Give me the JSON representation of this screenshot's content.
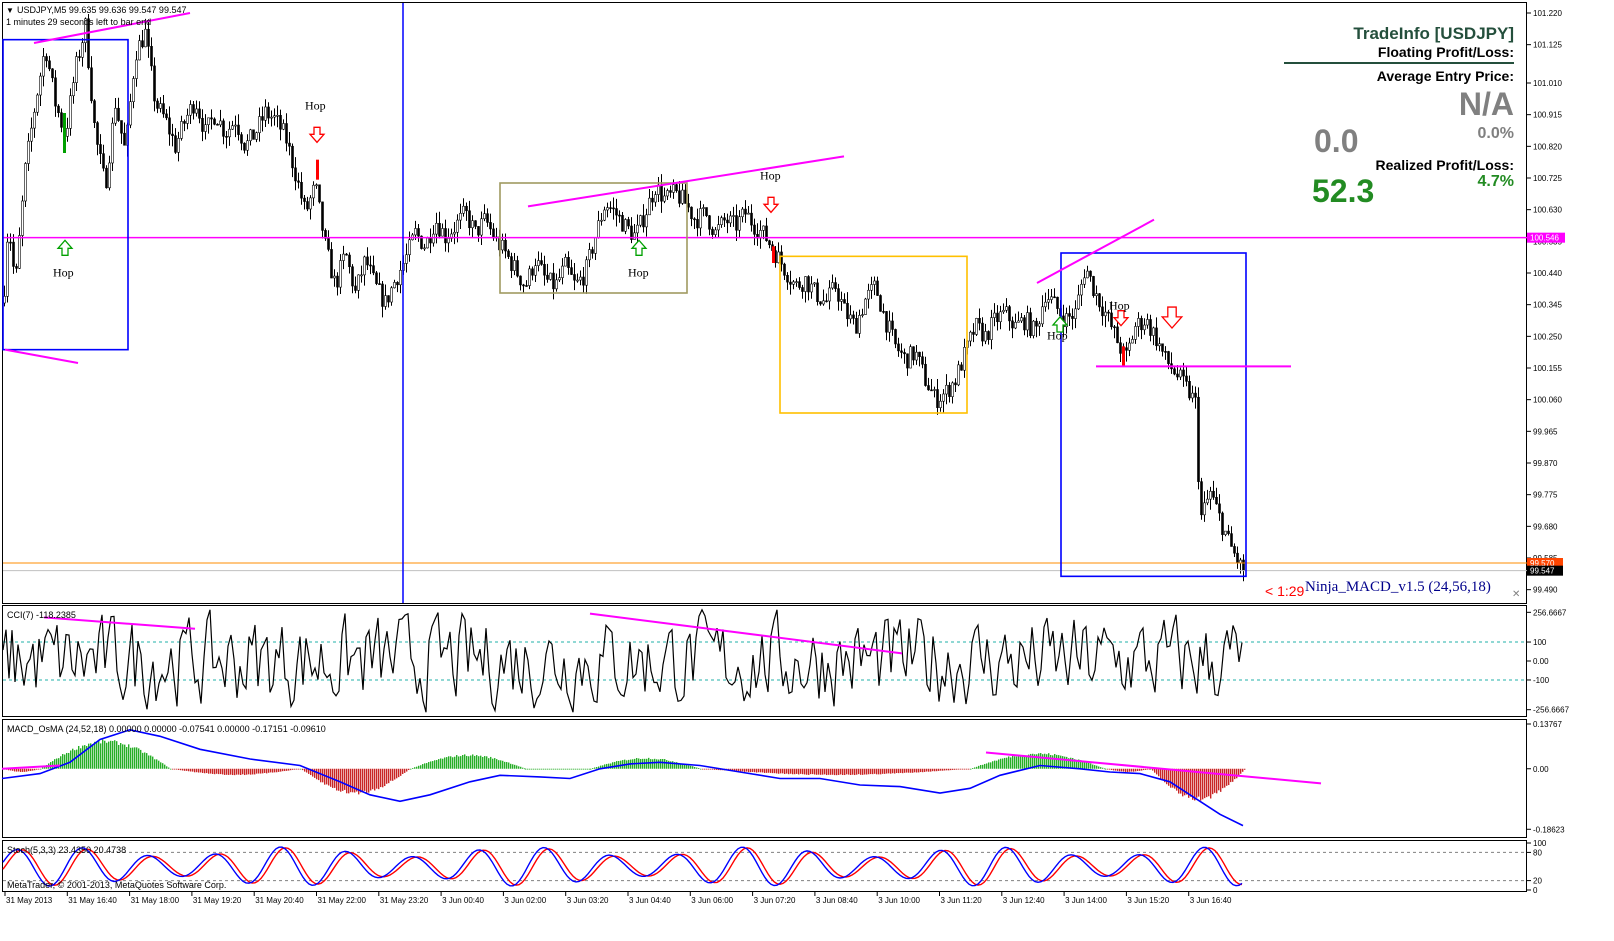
{
  "header": {
    "symbol_line": "USDJPY,M5  99.635 99.636 99.547 99.547",
    "countdown": "1 minutes 29 seconds left to bar end",
    "copyright": "MetaTrader, © 2001-2013, MetaQuotes Software Corp."
  },
  "tradeinfo": {
    "title": "TradeInfo [USDJPY]",
    "floating_label": "Floating Profit/Loss:",
    "avg_entry_label": "Average Entry Price:",
    "avg_entry_value": "N/A",
    "floating_value": "0.0",
    "floating_pct": "0.0%",
    "realized_label": "Realized Profit/Loss:",
    "realized_value": "52.3",
    "realized_pct": "4.7%"
  },
  "colors": {
    "magenta": "#ff00ff",
    "blue": "#0000ff",
    "olive": "#a09a60",
    "gold": "#ffc000",
    "red_arrow": "#ff0000",
    "green_arrow": "#00a000",
    "osma_green": "#00a000",
    "osma_red": "#c00000",
    "stoch_red": "#ff0000",
    "stoch_blue": "#0000ff",
    "text_green": "#228b22"
  },
  "chart_data": {
    "type": "candlestick",
    "symbol": "USDJPY",
    "timeframe": "M5",
    "bid": 99.547,
    "ask_label": "99.570",
    "bid_label": "99.547",
    "magenta_level_label": "100.546",
    "magenta_level": 100.546,
    "orange_level": 99.57,
    "ylim": [
      99.45,
      101.25
    ],
    "y_ticks": [
      "101.220",
      "101.125",
      "101.010",
      "100.915",
      "100.820",
      "100.725",
      "100.630",
      "100.535",
      "100.440",
      "100.345",
      "100.250",
      "100.155",
      "100.060",
      "99.965",
      "99.870",
      "99.775",
      "99.680",
      "99.585",
      "99.490"
    ],
    "x_ticks": [
      "31 May 2013",
      "31 May 16:40",
      "31 May 18:00",
      "31 May 19:20",
      "31 May 20:40",
      "31 May 22:00",
      "31 May 23:20",
      "3 Jun 00:40",
      "3 Jun 02:00",
      "3 Jun 03:20",
      "3 Jun 04:40",
      "3 Jun 06:00",
      "3 Jun 07:20",
      "3 Jun 08:40",
      "3 Jun 10:00",
      "3 Jun 11:20",
      "3 Jun 12:40",
      "3 Jun 14:00",
      "3 Jun 15:20",
      "3 Jun 16:40"
    ],
    "price_path": [
      [
        0,
        100.2
      ],
      [
        8,
        100.6
      ],
      [
        15,
        100.4
      ],
      [
        25,
        100.75
      ],
      [
        35,
        100.95
      ],
      [
        45,
        101.12
      ],
      [
        55,
        100.95
      ],
      [
        65,
        100.85
      ],
      [
        75,
        101.05
      ],
      [
        85,
        101.18
      ],
      [
        95,
        100.85
      ],
      [
        105,
        100.7
      ],
      [
        115,
        100.95
      ],
      [
        125,
        100.8
      ],
      [
        135,
        101.1
      ],
      [
        145,
        101.16
      ],
      [
        155,
        100.95
      ],
      [
        165,
        100.9
      ],
      [
        175,
        100.82
      ],
      [
        185,
        100.9
      ],
      [
        195,
        100.96
      ],
      [
        205,
        100.86
      ],
      [
        215,
        100.92
      ],
      [
        225,
        100.86
      ],
      [
        235,
        100.9
      ],
      [
        245,
        100.82
      ],
      [
        255,
        100.86
      ],
      [
        265,
        100.92
      ],
      [
        275,
        100.9
      ],
      [
        285,
        100.85
      ],
      [
        295,
        100.74
      ],
      [
        305,
        100.62
      ],
      [
        315,
        100.7
      ],
      [
        325,
        100.52
      ],
      [
        335,
        100.4
      ],
      [
        345,
        100.5
      ],
      [
        355,
        100.38
      ],
      [
        365,
        100.48
      ],
      [
        375,
        100.4
      ],
      [
        385,
        100.35
      ],
      [
        395,
        100.42
      ],
      [
        405,
        100.48
      ],
      [
        415,
        100.56
      ],
      [
        425,
        100.52
      ],
      [
        435,
        100.6
      ],
      [
        445,
        100.55
      ],
      [
        455,
        100.58
      ],
      [
        465,
        100.62
      ],
      [
        475,
        100.56
      ],
      [
        485,
        100.6
      ],
      [
        495,
        100.54
      ],
      [
        505,
        100.5
      ],
      [
        515,
        100.45
      ],
      [
        525,
        100.4
      ],
      [
        535,
        100.48
      ],
      [
        545,
        100.42
      ],
      [
        555,
        100.4
      ],
      [
        565,
        100.46
      ],
      [
        575,
        100.4
      ],
      [
        585,
        100.44
      ],
      [
        595,
        100.55
      ],
      [
        605,
        100.65
      ],
      [
        615,
        100.62
      ],
      [
        625,
        100.58
      ],
      [
        635,
        100.55
      ],
      [
        645,
        100.62
      ],
      [
        655,
        100.7
      ],
      [
        665,
        100.66
      ],
      [
        675,
        100.68
      ],
      [
        685,
        100.65
      ],
      [
        695,
        100.6
      ],
      [
        705,
        100.62
      ],
      [
        715,
        100.56
      ],
      [
        725,
        100.6
      ],
      [
        735,
        100.58
      ],
      [
        745,
        100.62
      ],
      [
        755,
        100.58
      ],
      [
        765,
        100.55
      ],
      [
        775,
        100.5
      ],
      [
        785,
        100.45
      ],
      [
        795,
        100.4
      ],
      [
        805,
        100.42
      ],
      [
        815,
        100.38
      ],
      [
        825,
        100.35
      ],
      [
        835,
        100.4
      ],
      [
        845,
        100.32
      ],
      [
        855,
        100.28
      ],
      [
        865,
        100.36
      ],
      [
        875,
        100.4
      ],
      [
        885,
        100.3
      ],
      [
        895,
        100.22
      ],
      [
        905,
        100.18
      ],
      [
        915,
        100.2
      ],
      [
        925,
        100.12
      ],
      [
        935,
        100.06
      ],
      [
        945,
        100.08
      ],
      [
        955,
        100.12
      ],
      [
        965,
        100.2
      ],
      [
        975,
        100.28
      ],
      [
        985,
        100.25
      ],
      [
        995,
        100.3
      ],
      [
        1005,
        100.32
      ],
      [
        1015,
        100.28
      ],
      [
        1025,
        100.3
      ],
      [
        1035,
        100.26
      ],
      [
        1045,
        100.38
      ],
      [
        1055,
        100.34
      ],
      [
        1065,
        100.3
      ],
      [
        1075,
        100.32
      ],
      [
        1085,
        100.46
      ],
      [
        1095,
        100.38
      ],
      [
        1105,
        100.32
      ],
      [
        1115,
        100.25
      ],
      [
        1125,
        100.18
      ],
      [
        1135,
        100.28
      ],
      [
        1145,
        100.3
      ],
      [
        1155,
        100.25
      ],
      [
        1165,
        100.18
      ],
      [
        1175,
        100.14
      ],
      [
        1185,
        100.1
      ],
      [
        1195,
        100.05
      ],
      [
        1200,
        99.7
      ],
      [
        1210,
        99.78
      ],
      [
        1220,
        99.7
      ],
      [
        1230,
        99.62
      ],
      [
        1240,
        99.56
      ],
      [
        1244,
        99.547
      ]
    ],
    "trendlines": [
      {
        "x1": 34,
        "y1": 101.13,
        "x2": 190,
        "y2": 101.22
      },
      {
        "x1": 5,
        "y1": 100.21,
        "x2": 78,
        "y2": 100.17
      },
      {
        "x1": 528,
        "y1": 100.64,
        "x2": 844,
        "y2": 100.79
      },
      {
        "x1": 1037,
        "y1": 100.41,
        "x2": 1154,
        "y2": 100.6
      },
      {
        "x1": 1096,
        "y1": 100.16,
        "x2": 1291,
        "y2": 100.16
      }
    ],
    "boxes": [
      {
        "x1": 3,
        "y1": 101.14,
        "x2": 128,
        "y2": 100.21,
        "color": "blue"
      },
      {
        "x1": 500,
        "y1": 100.71,
        "x2": 687,
        "y2": 100.38,
        "color": "olive"
      },
      {
        "x1": 780,
        "y1": 100.49,
        "x2": 967,
        "y2": 100.02,
        "color": "gold"
      },
      {
        "x1": 1061,
        "y1": 100.5,
        "x2": 1246,
        "y2": 99.53,
        "color": "blue"
      }
    ],
    "vline_x": 403,
    "annotations": [
      {
        "text": "Hop",
        "x": 305,
        "y": 100.93
      },
      {
        "text": "Hop",
        "x": 53,
        "y": 100.43
      },
      {
        "text": "Hop",
        "x": 628,
        "y": 100.43
      },
      {
        "text": "Hop",
        "x": 760,
        "y": 100.72
      },
      {
        "text": "Hop",
        "x": 1109,
        "y": 100.33
      },
      {
        "text": "Hop",
        "x": 1047,
        "y": 100.24
      }
    ],
    "arrows": [
      {
        "dir": "down",
        "x": 317,
        "y": 100.85,
        "size": 1
      },
      {
        "dir": "up",
        "x": 65,
        "y": 100.52,
        "size": 1
      },
      {
        "dir": "up",
        "x": 639,
        "y": 100.52,
        "size": 1
      },
      {
        "dir": "down",
        "x": 771,
        "y": 100.64,
        "size": 1
      },
      {
        "dir": "down",
        "x": 1121,
        "y": 100.3,
        "size": 1
      },
      {
        "dir": "down",
        "x": 1172,
        "y": 100.3,
        "size": 1.4
      },
      {
        "dir": "up",
        "x": 1060,
        "y": 100.29,
        "size": 1
      }
    ],
    "indicator_label": "Ninja_MACD_v1.5 (24,56,18)",
    "bar_timer": "< 1:29",
    "cci": {
      "label": "CCI(7) -118.2385",
      "ylim": [
        -290,
        290
      ],
      "ticks": [
        "256.6667",
        "100",
        "0.00",
        "-100",
        "-256.6667"
      ],
      "levels": [
        100,
        -100
      ],
      "divergence_lines": [
        {
          "x1": 44,
          "y1": 230,
          "x2": 195,
          "y2": 170
        },
        {
          "x1": 590,
          "y1": 250,
          "x2": 902,
          "y2": 40
        }
      ]
    },
    "macd": {
      "label": "MACD_OsMA (24,52,18) 0.00000 0.00000 -0.07541 0.00000 -0.17151 -0.09610",
      "ylim": [
        -0.21,
        0.15
      ],
      "ticks": [
        "0.13767",
        "0.00",
        "-0.18623"
      ],
      "osma_segments": [
        {
          "x1": 2,
          "x2": 40,
          "peak": -0.01
        },
        {
          "x1": 40,
          "x2": 170,
          "peak": 0.09
        },
        {
          "x1": 170,
          "x2": 300,
          "peak": -0.02
        },
        {
          "x1": 300,
          "x2": 410,
          "peak": -0.08
        },
        {
          "x1": 410,
          "x2": 525,
          "peak": 0.045
        },
        {
          "x1": 525,
          "x2": 590,
          "peak": 0.0
        },
        {
          "x1": 590,
          "x2": 700,
          "peak": 0.035
        },
        {
          "x1": 700,
          "x2": 970,
          "peak": -0.02
        },
        {
          "x1": 970,
          "x2": 1105,
          "peak": 0.05
        },
        {
          "x1": 1105,
          "x2": 1150,
          "peak": -0.01
        },
        {
          "x1": 1150,
          "x2": 1245,
          "peak": -0.1
        }
      ],
      "macd_line": [
        [
          2,
          -0.03
        ],
        [
          40,
          -0.015
        ],
        [
          70,
          0.02
        ],
        [
          100,
          0.09
        ],
        [
          130,
          0.12
        ],
        [
          160,
          0.1
        ],
        [
          200,
          0.06
        ],
        [
          250,
          0.03
        ],
        [
          300,
          0.01
        ],
        [
          340,
          -0.04
        ],
        [
          370,
          -0.08
        ],
        [
          400,
          -0.1
        ],
        [
          430,
          -0.08
        ],
        [
          470,
          -0.04
        ],
        [
          500,
          -0.02
        ],
        [
          540,
          -0.025
        ],
        [
          570,
          -0.03
        ],
        [
          600,
          0.0
        ],
        [
          630,
          0.015
        ],
        [
          660,
          0.02
        ],
        [
          700,
          0.01
        ],
        [
          740,
          -0.01
        ],
        [
          780,
          -0.03
        ],
        [
          820,
          -0.03
        ],
        [
          860,
          -0.05
        ],
        [
          900,
          -0.055
        ],
        [
          940,
          -0.075
        ],
        [
          970,
          -0.06
        ],
        [
          1000,
          -0.02
        ],
        [
          1040,
          0.01
        ],
        [
          1080,
          -0.0
        ],
        [
          1110,
          -0.01
        ],
        [
          1140,
          -0.015
        ],
        [
          1170,
          -0.04
        ],
        [
          1200,
          -0.1
        ],
        [
          1220,
          -0.14
        ],
        [
          1243,
          -0.175
        ]
      ],
      "divergence_lines": [
        {
          "x1": 2,
          "y1": 0.0,
          "x2": 60,
          "y2": 0.01
        },
        {
          "x1": 986,
          "y1": 0.05,
          "x2": 1321,
          "y2": -0.045
        }
      ]
    },
    "stoch": {
      "label": "Stoch(5,3,3) 23.4350 20.4738",
      "ylim": [
        0,
        100
      ],
      "ticks": [
        "100",
        "80",
        "20",
        "0"
      ],
      "levels": [
        80,
        20
      ]
    }
  }
}
